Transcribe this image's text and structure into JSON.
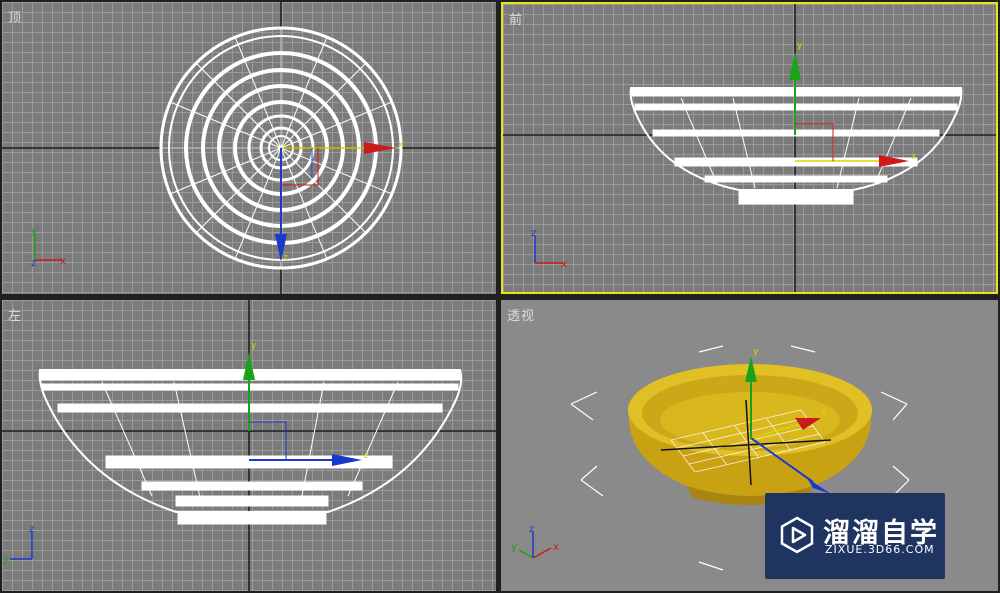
{
  "viewports": {
    "top": {
      "label": "顶"
    },
    "front": {
      "label": "前",
      "active": true
    },
    "left": {
      "label": "左"
    },
    "persp": {
      "label": "透视"
    }
  },
  "axes": {
    "x": "x",
    "y": "y",
    "z": "z"
  },
  "colors": {
    "active_border": "#e6e41a",
    "x_axis": "#cc1a1a",
    "y_axis": "#1aa31a",
    "z_axis": "#1a3acc",
    "bowl_gold": "#e0c024",
    "wireframe": "#ffffff"
  },
  "watermark": {
    "name": "溜溜自学",
    "url": "ZIXUE.3D66.COM"
  }
}
